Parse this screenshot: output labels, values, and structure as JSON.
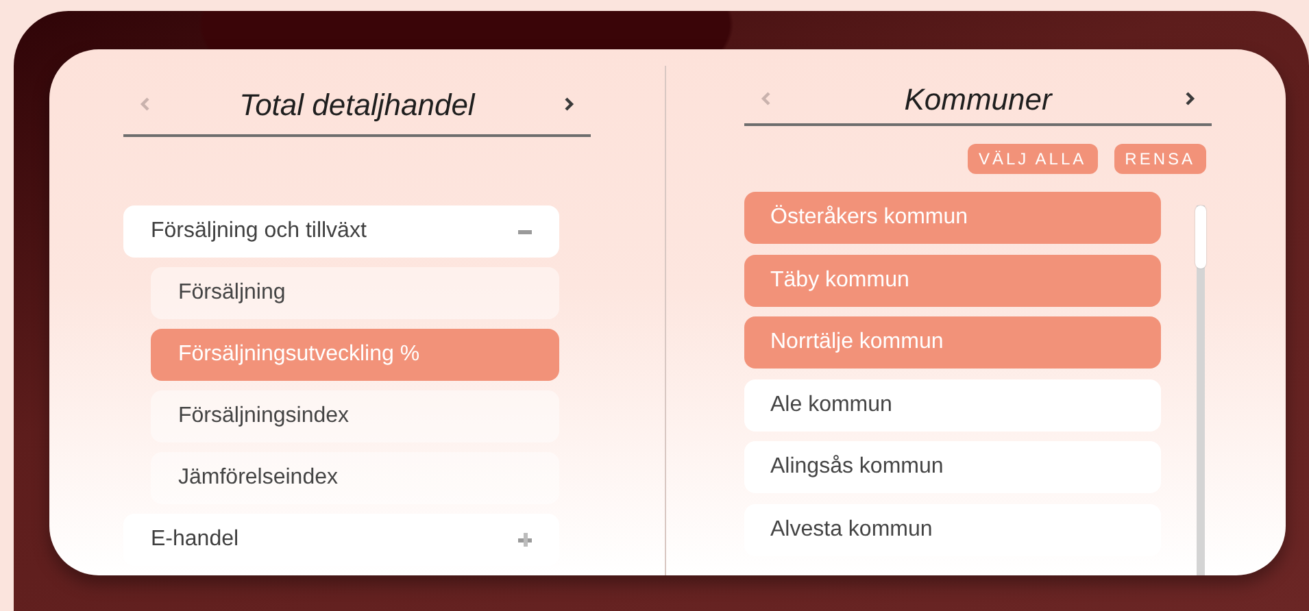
{
  "left_panel": {
    "title": "Total detaljhandel",
    "prev_enabled": false,
    "next_enabled": true,
    "groups": [
      {
        "label": "Försäljning och tillväxt",
        "expanded": true,
        "children": [
          {
            "label": "Försäljning",
            "selected": false
          },
          {
            "label": "Försäljningsutveckling %",
            "selected": true
          },
          {
            "label": "Försäljningsindex",
            "selected": false
          },
          {
            "label": "Jämförelseindex",
            "selected": false
          }
        ]
      },
      {
        "label": "E-handel",
        "expanded": false
      }
    ]
  },
  "right_panel": {
    "title": "Kommuner",
    "prev_enabled": false,
    "next_enabled": true,
    "buttons": [
      "VÄLJ ALLA",
      "RENSA"
    ],
    "items": [
      {
        "label": "Österåkers kommun",
        "selected": true
      },
      {
        "label": "Täby kommun",
        "selected": true
      },
      {
        "label": "Norrtälje kommun",
        "selected": true
      },
      {
        "label": "Ale kommun",
        "selected": false
      },
      {
        "label": "Alingsås kommun",
        "selected": false
      },
      {
        "label": "Alvesta kommun",
        "selected": false
      }
    ]
  }
}
